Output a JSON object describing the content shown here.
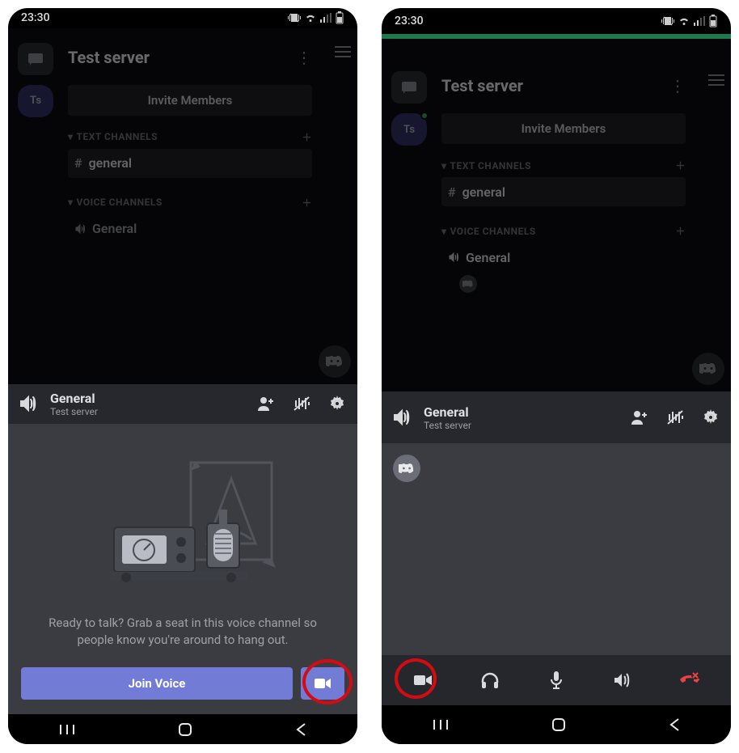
{
  "statusbar": {
    "time": "23:30"
  },
  "server": {
    "title": "Test server",
    "invite_label": "Invite Members",
    "avatar_initials": "Ts",
    "text_channels_label": "TEXT CHANNELS",
    "voice_channels_label": "VOICE CHANNELS",
    "text_channels": [
      {
        "name": "general"
      }
    ],
    "voice_channels": [
      {
        "name": "General"
      }
    ]
  },
  "voice_panel": {
    "channel_name": "General",
    "server_name": "Test server",
    "prompt_line1": "Ready to talk? Grab a seat in this voice channel so",
    "prompt_line2": "people know you're around to hang out.",
    "join_label": "Join Voice"
  }
}
